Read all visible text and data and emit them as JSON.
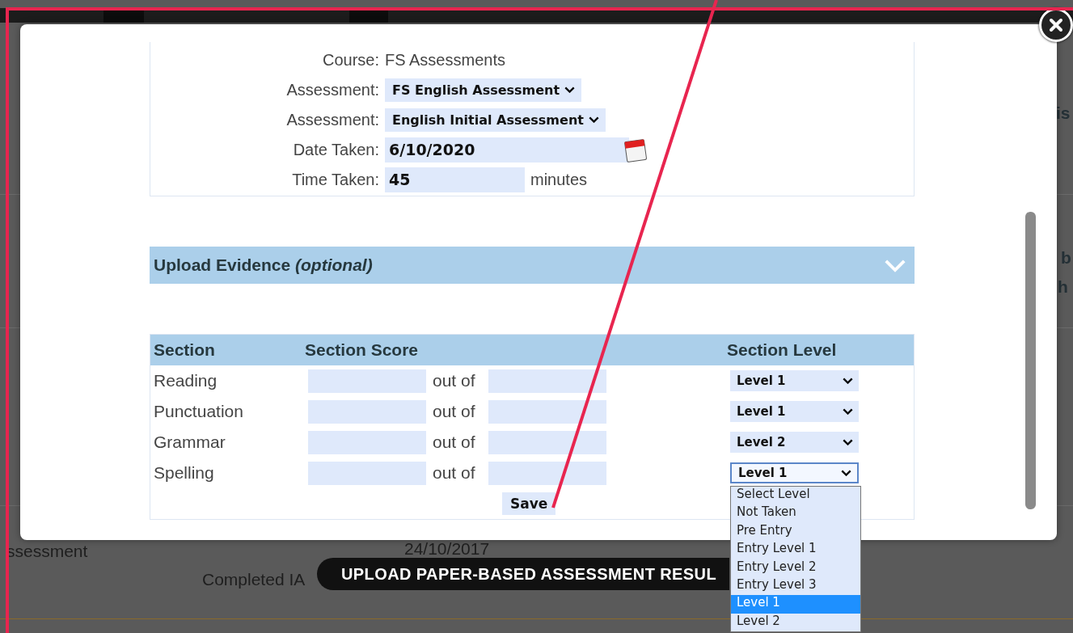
{
  "background_page": {
    "fragments": [
      {
        "kind": "edge",
        "text": "is"
      },
      {
        "kind": "edge",
        "text": "b"
      },
      {
        "kind": "edge",
        "text": "h"
      },
      {
        "kind": "cell",
        "text": "ssessment"
      },
      {
        "kind": "cell",
        "text": "24/10/2017"
      },
      {
        "kind": "cell",
        "text": "Completed IA"
      }
    ],
    "upload_button": "UPLOAD PAPER-BASED ASSESSMENT RESUL"
  },
  "dialog": {
    "fields": [
      {
        "kind": "text",
        "label": "Course:",
        "value": "FS Assessments"
      },
      {
        "kind": "select",
        "label": "Assessment:",
        "value": "FS English Assessment"
      },
      {
        "kind": "select",
        "label": "Assessment:",
        "value": "English Initial Assessment"
      },
      {
        "kind": "date",
        "label": "Date Taken:",
        "value": "6/10/2020"
      },
      {
        "kind": "number",
        "label": "Time Taken:",
        "value": "45",
        "unit": "minutes"
      }
    ],
    "upload_panel": {
      "title": "Upload Evidence",
      "hint": "(optional)",
      "expanded": false
    },
    "sections_table": {
      "columns": [
        "Section",
        "Section Score",
        "Section Level"
      ],
      "rows": [
        {
          "name": "Reading",
          "separator": "out of",
          "level": "Level 1",
          "open": false
        },
        {
          "name": "Punctuation",
          "separator": "out of",
          "level": "Level 1",
          "open": false
        },
        {
          "name": "Grammar",
          "separator": "out of",
          "level": "Level 2",
          "open": false
        },
        {
          "name": "Spelling",
          "separator": "out of",
          "level": "Level 1",
          "open": true
        }
      ],
      "save_button": "Save"
    },
    "level_options": [
      {
        "label": "Select Level",
        "selected": false
      },
      {
        "label": "Not Taken",
        "selected": false
      },
      {
        "label": "Pre Entry",
        "selected": false
      },
      {
        "label": "Entry Level 1",
        "selected": false
      },
      {
        "label": "Entry Level 2",
        "selected": false
      },
      {
        "label": "Entry Level 3",
        "selected": false
      },
      {
        "label": "Level 1",
        "selected": true
      },
      {
        "label": "Level 2",
        "selected": false
      }
    ]
  }
}
